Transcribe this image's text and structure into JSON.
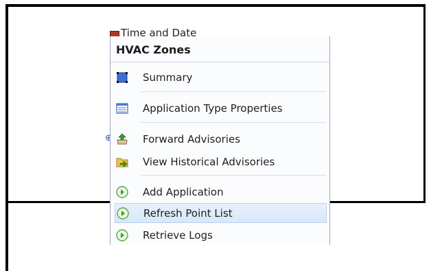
{
  "background_item": {
    "label": "Time and Date"
  },
  "left_fragment": "⊕",
  "menu": {
    "title": "HVAC Zones",
    "items": [
      {
        "label": "Summary",
        "icon": "summary-icon"
      },
      {
        "label": "Application Type Properties",
        "icon": "properties-list-icon"
      },
      {
        "label": "Forward Advisories",
        "icon": "forward-advisories-icon"
      },
      {
        "label": "View Historical Advisories",
        "icon": "historical-advisories-icon"
      },
      {
        "label": "Add Application",
        "icon": "green-arrow-icon"
      },
      {
        "label": "Refresh Point List",
        "icon": "green-arrow-icon"
      },
      {
        "label": "Retrieve Logs",
        "icon": "green-arrow-icon"
      }
    ],
    "hovered_item": "Refresh Point List"
  },
  "colors": {
    "hover_bg": "#d8e7fa",
    "hover_border": "#b8d0ef",
    "menu_border": "#9aa7bc",
    "green_icon": "#3c9b2e"
  }
}
